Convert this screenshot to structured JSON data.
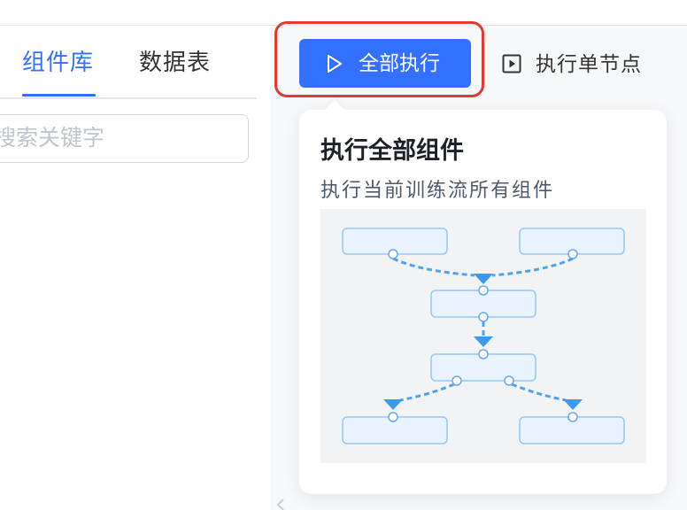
{
  "left_panel": {
    "tabs": [
      {
        "label": "组件库",
        "active": true
      },
      {
        "label": "数据表",
        "active": false
      }
    ],
    "search": {
      "placeholder": "搜索关键字"
    }
  },
  "toolbar": {
    "run_all": {
      "label": "全部执行",
      "icon": "play-icon"
    },
    "run_node": {
      "label": "执行单节点",
      "icon": "play-square-icon"
    }
  },
  "popover": {
    "title": "执行全部组件",
    "description": "执行当前训练流所有组件"
  },
  "colors": {
    "primary": "#3370ff",
    "highlight": "#e4392e",
    "text": "#1d2129",
    "muted": "#4e5969",
    "placeholder": "#c0c4cc",
    "canvas": "#f7f8fa",
    "node_fill": "#e8f3ff",
    "node_stroke": "#94c6f7",
    "connector": "#4da3f2"
  }
}
